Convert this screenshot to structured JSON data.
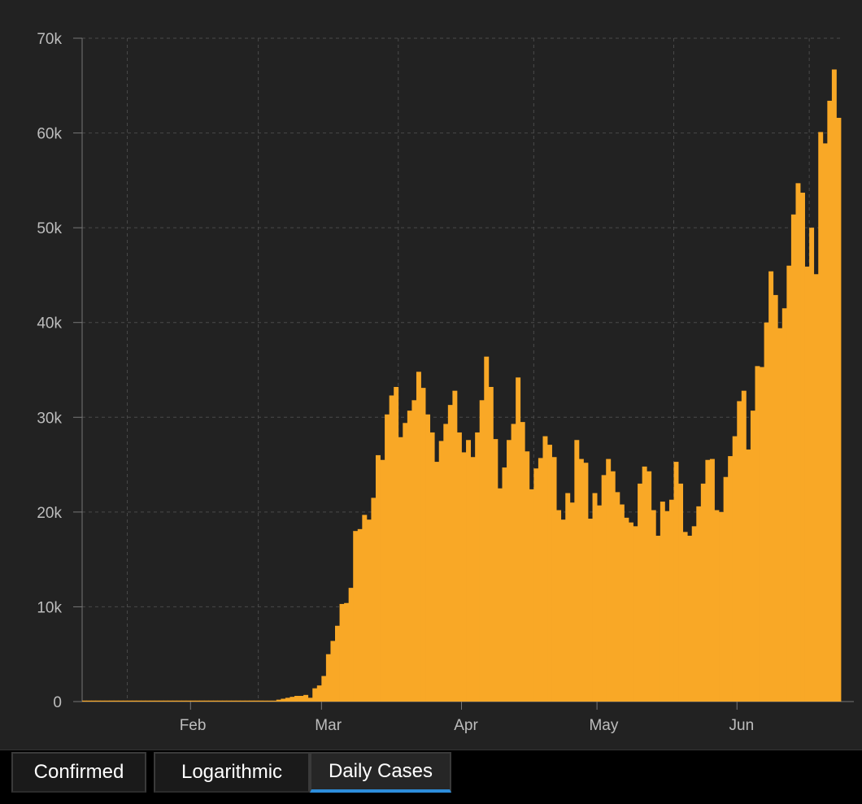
{
  "chart_data": {
    "type": "bar",
    "x_start": "2020-01-22",
    "x_ticks": [
      "Feb",
      "Mar",
      "Apr",
      "May",
      "Jun"
    ],
    "y_ticks": [
      "0",
      "10k",
      "20k",
      "30k",
      "40k",
      "50k",
      "60k",
      "70k"
    ],
    "ylim": [
      0,
      70000
    ],
    "grid": true,
    "bar_color": "#f9a826",
    "values": [
      0,
      0,
      0,
      0,
      0,
      0,
      0,
      0,
      0,
      0,
      0,
      0,
      0,
      0,
      0,
      0,
      0,
      0,
      0,
      0,
      0,
      0,
      0,
      0,
      0,
      0,
      0,
      0,
      0,
      0,
      0,
      0,
      0,
      0,
      0,
      0,
      0,
      0,
      0,
      0,
      100,
      100,
      100,
      200,
      300,
      400,
      500,
      600,
      600,
      700,
      400,
      1400,
      1700,
      2700,
      5000,
      6400,
      8000,
      10300,
      10400,
      12000,
      18000,
      18200,
      19700,
      19200,
      21500,
      26000,
      25500,
      30300,
      32300,
      33200,
      27900,
      29400,
      30700,
      31800,
      34800,
      33100,
      30300,
      28400,
      25300,
      27500,
      29300,
      31300,
      32800,
      28400,
      26300,
      27600,
      25800,
      28400,
      31800,
      36400,
      33200,
      27700,
      22500,
      24700,
      27600,
      29300,
      34200,
      29500,
      26400,
      22400,
      24600,
      25700,
      28000,
      27100,
      25800,
      20200,
      19200,
      22000,
      21000,
      27600,
      25600,
      25200,
      19300,
      22000,
      20700,
      23900,
      25600,
      24300,
      22100,
      20800,
      19400,
      18900,
      18500,
      23000,
      24800,
      24300,
      20200,
      17500,
      21100,
      20100,
      21300,
      25300,
      23000,
      17900,
      17500,
      18500,
      20600,
      23000,
      25500,
      25600,
      20200,
      20000,
      23700,
      25900,
      28000,
      31700,
      32800,
      26600,
      30700,
      35400,
      35300,
      40000,
      45400,
      42900,
      39400,
      41500,
      46000,
      51400,
      54700,
      53700,
      45900,
      50000,
      45100,
      60100,
      58900,
      63400,
      66700,
      61600
    ]
  },
  "tabs": {
    "confirmed": "Confirmed",
    "logarithmic": "Logarithmic",
    "daily_cases": "Daily Cases"
  }
}
